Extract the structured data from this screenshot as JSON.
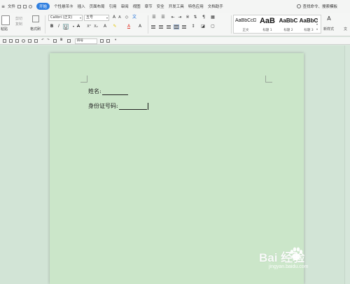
{
  "menubar": {
    "file": "文件",
    "tabs": [
      "开始",
      "个性悬吊卡",
      "插入",
      "页面布局",
      "引用",
      "审阅",
      "视图",
      "章节",
      "安全",
      "开发工具",
      "特色应用",
      "文档助手"
    ],
    "search": "查找命令、搜索模板"
  },
  "ribbon": {
    "paste": "粘贴",
    "cut": "剪切",
    "copy": "复制",
    "format_painter": "格式刷",
    "font_name": "Calibri (正文)",
    "font_size": "五号",
    "styles": [
      {
        "sample": "AaBbCcDd",
        "name": "正文"
      },
      {
        "sample": "AaB",
        "name": "标题 1"
      },
      {
        "sample": "AaBbC",
        "name": "标题 2"
      },
      {
        "sample": "AaBbC",
        "name": "标题 3"
      }
    ],
    "new_style": "新样式",
    "more": "文"
  },
  "quickbar": {
    "font_size": "四号"
  },
  "document": {
    "name_label": "姓名:",
    "id_label": "身份证号码:"
  },
  "watermark": {
    "logo": "Bai  经验",
    "sub": "jingyan.baidu.com"
  },
  "colors": {
    "page": "#cbe6c9",
    "accent": "#2f7fe0",
    "font_color_red": "#e03a2e"
  }
}
